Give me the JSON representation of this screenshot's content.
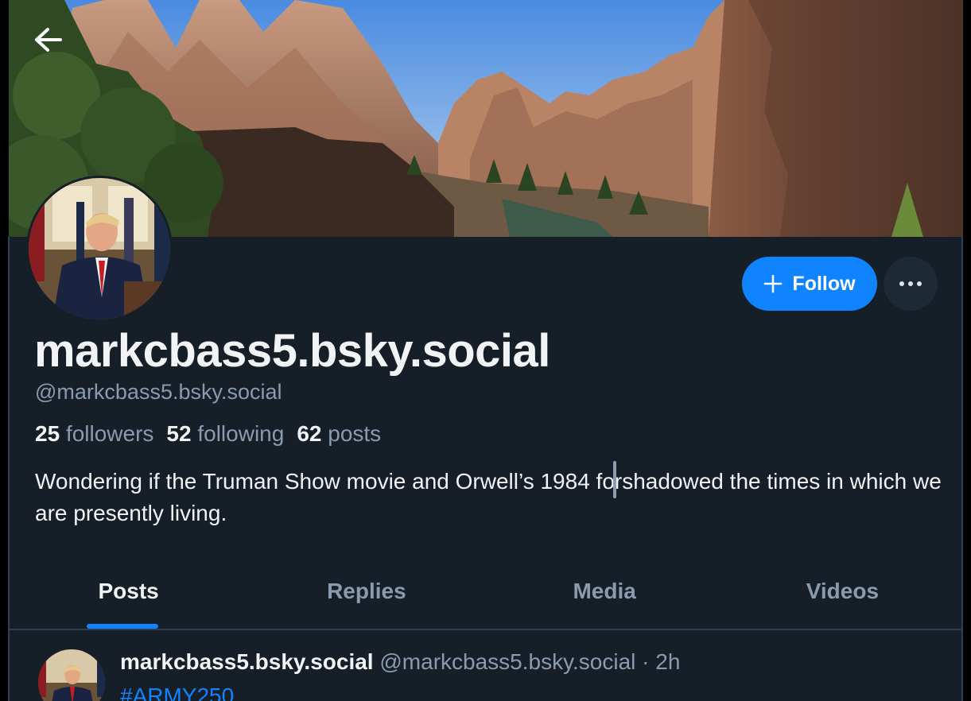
{
  "profile": {
    "display_name": "markcbass5.bsky.social",
    "handle": "@markcbass5.bsky.social",
    "followers_count": "25",
    "followers_label": "followers",
    "following_count": "52",
    "following_label": "following",
    "posts_count": "62",
    "posts_label": "posts",
    "bio": "Wondering if the Truman Show movie and Orwell’s 1984 forshadowed the times in which we are presently living."
  },
  "actions": {
    "follow_label": "Follow"
  },
  "tabs": [
    {
      "label": "Posts",
      "active": true
    },
    {
      "label": "Replies",
      "active": false
    },
    {
      "label": "Media",
      "active": false
    },
    {
      "label": "Videos",
      "active": false
    }
  ],
  "post": {
    "author": "markcbass5.bsky.social",
    "handle": "@markcbass5.bsky.social",
    "separator": "·",
    "time": "2h",
    "text": "#ARMY250"
  },
  "colors": {
    "background": "#161e27",
    "accent": "#1083fe",
    "muted_text": "#8a9bb0",
    "primary_text": "#f1f3f5"
  },
  "icons": {
    "back": "arrow-left-icon",
    "follow": "plus-icon",
    "more": "ellipsis-icon"
  }
}
